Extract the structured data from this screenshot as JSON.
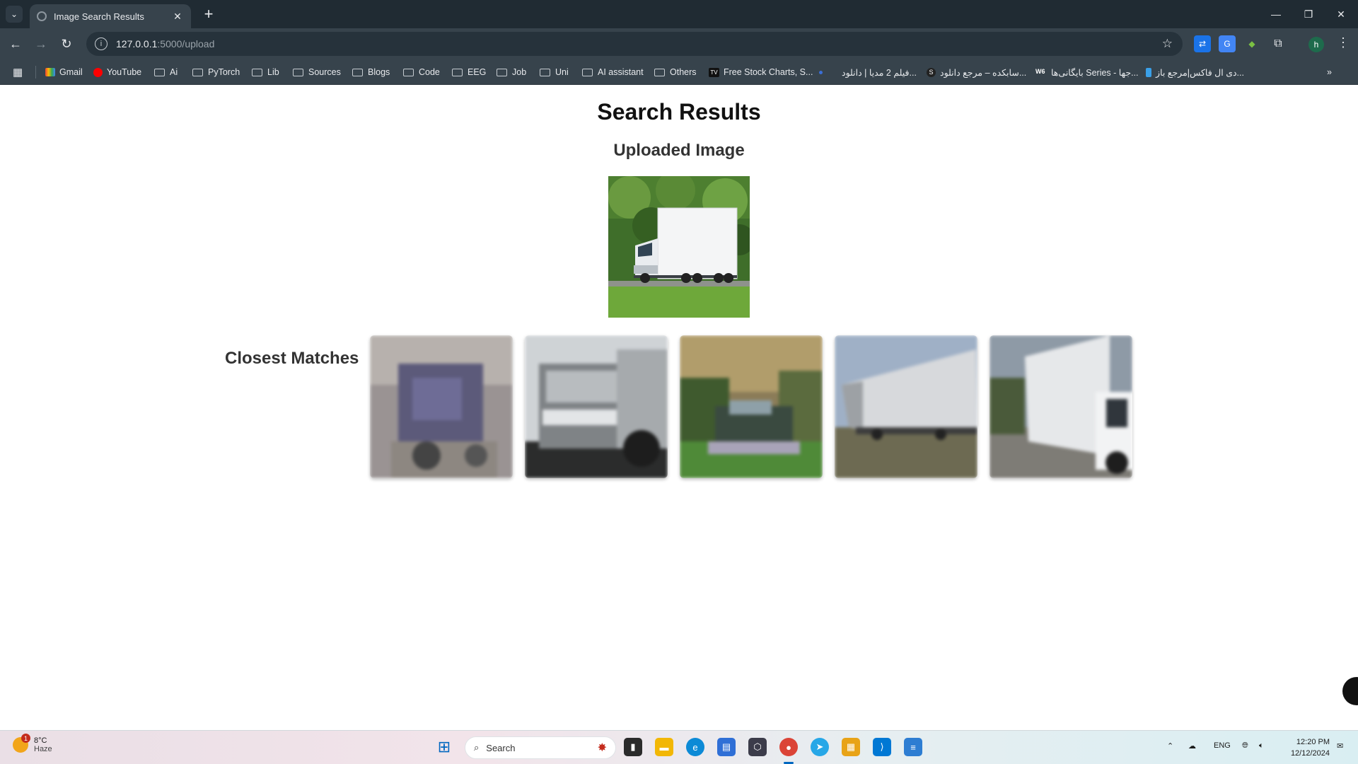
{
  "browser": {
    "tab_title": "Image Search Results",
    "url_host": "127.0.0.1",
    "url_path": ":5000/upload",
    "profile_initial": "h",
    "bookmarks": [
      {
        "label": "Gmail",
        "icon": "gmail-icon"
      },
      {
        "label": "YouTube",
        "icon": "youtube-icon"
      },
      {
        "label": "Ai",
        "icon": "folder-icon"
      },
      {
        "label": "PyTorch",
        "icon": "folder-icon"
      },
      {
        "label": "Lib",
        "icon": "folder-icon"
      },
      {
        "label": "Sources",
        "icon": "folder-icon"
      },
      {
        "label": "Blogs",
        "icon": "folder-icon"
      },
      {
        "label": "Code",
        "icon": "folder-icon"
      },
      {
        "label": "EEG",
        "icon": "folder-icon"
      },
      {
        "label": "Job",
        "icon": "folder-icon"
      },
      {
        "label": "Uni",
        "icon": "folder-icon"
      },
      {
        "label": "AI assistant",
        "icon": "folder-icon"
      },
      {
        "label": "Others",
        "icon": "folder-icon"
      },
      {
        "label": "Free Stock Charts, S...",
        "icon": "tradingview-icon"
      },
      {
        "label": "",
        "icon": "dot-icon"
      },
      {
        "label": "فیلم 2 مدیا | دانلود...",
        "icon": "site-icon"
      },
      {
        "label": "سابکده – مرجع دانلود...",
        "icon": "subkade-icon"
      },
      {
        "label": "بایگانی‌ها Series - جها...",
        "icon": "w6-icon"
      },
      {
        "label": "دی ال فاکس|مرجع باز...",
        "icon": "dlfox-icon"
      }
    ]
  },
  "page": {
    "title": "Search Results",
    "uploaded_heading": "Uploaded Image",
    "matches_heading": "Closest Matches",
    "uploaded_image": "white-box-truck-on-road-with-trees",
    "matches": [
      {
        "name": "match-1",
        "description": "blurry-purple-truck"
      },
      {
        "name": "match-2",
        "description": "blurry-grey-truck-front"
      },
      {
        "name": "match-3",
        "description": "blurry-dark-vehicle-green-background"
      },
      {
        "name": "match-4",
        "description": "blurry-white-trailer-truck"
      },
      {
        "name": "match-5",
        "description": "blurry-white-box-truck"
      }
    ]
  },
  "taskbar": {
    "weather_temp": "8°C",
    "weather_desc": "Haze",
    "weather_badge": "1",
    "search_placeholder": "Search",
    "language": "ENG",
    "time": "12:20 PM",
    "date": "12/12/2024"
  },
  "colors": {
    "chrome_dark": "#202b33",
    "chrome_toolbar": "#37434c",
    "heading": "#111111"
  }
}
